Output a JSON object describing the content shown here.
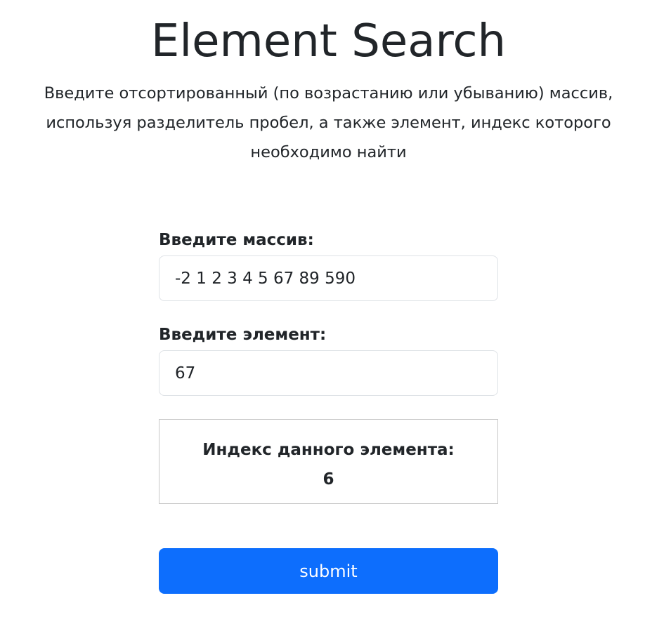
{
  "header": {
    "title": "Element Search",
    "description": "Введите отсортированный (по возрастанию или убыванию) массив, используя разделитель пробел, а также элемент, индекс которого необходимо найти"
  },
  "form": {
    "array_label": "Введите массив:",
    "array_value": "-2 1 2 3 4 5 67 89 590",
    "element_label": "Введите элемент:",
    "element_value": "67"
  },
  "result": {
    "label": "Индекс данного элемента:",
    "value": "6"
  },
  "submit": {
    "label": "submit",
    "color": "#0d6efd"
  }
}
